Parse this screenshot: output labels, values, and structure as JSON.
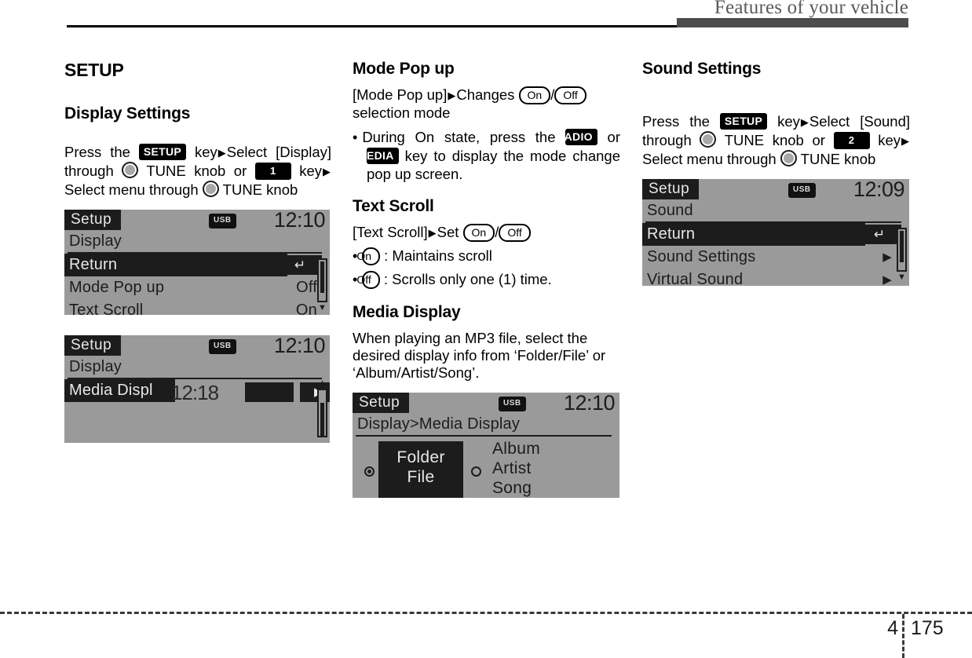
{
  "header": {
    "title": "Features of your vehicle"
  },
  "footer": {
    "chapter": "4",
    "page": "175"
  },
  "glyphs": {
    "setup_key": "SETUP",
    "radio_key": "RADIO",
    "media_key": "MEDIA",
    "key_1": "1",
    "key_2": "2",
    "on_pill": "On",
    "off_pill": "Off",
    "arrow": "▶",
    "usb_badge": "USB",
    "return_arrow": "↵",
    "submenu_arrow": "▶",
    "caret_down": "▼",
    "caret_up": "▲"
  },
  "column1": {
    "section_title": "SETUP",
    "display_settings": {
      "heading": "Display Settings",
      "instruction_parts": {
        "p1": "Press the",
        "p2": "key",
        "p3": "Select [Display]",
        "p4": "through",
        "p5": "TUNE knob or",
        "p6": "key",
        "p7": "Select menu through",
        "p8": "TUNE knob"
      }
    },
    "lcd_display_menu": {
      "title": "Setup",
      "usb": "USB",
      "clock": "12:10",
      "breadcrumb": "Display",
      "rows": [
        {
          "label": "Return",
          "value": "",
          "selected": true,
          "kind": "return"
        },
        {
          "label": "Mode Pop up",
          "value": "Off",
          "selected": false,
          "kind": "value"
        },
        {
          "label": "Text Scroll",
          "value": "On",
          "selected": false,
          "kind": "value"
        }
      ]
    },
    "lcd_media_menu": {
      "title": "Setup",
      "usb": "USB",
      "clock": "12:10",
      "breadcrumb": "Display",
      "rows": [
        {
          "label": "Media Displ",
          "value": "",
          "selected": true,
          "kind": "submenu"
        }
      ],
      "artifact_time": "12:18"
    }
  },
  "column2": {
    "mode_pop_up": {
      "heading": "Mode Pop up",
      "line1_a": "[Mode Pop up]",
      "line1_b": "Changes",
      "line1_on": "On",
      "line1_off": "Off",
      "line2": "selection mode",
      "bullet1_a": "During On state, press the",
      "bullet1_radio": "RADIO",
      "bullet1_b": "or",
      "bullet1_media": "MEDIA",
      "bullet1_c": "key to display the mode change pop up screen."
    },
    "text_scroll": {
      "heading": "Text Scroll",
      "line1_a": "[Text Scroll]",
      "line1_b": "Set",
      "line1_on": "On",
      "line1_off": "Off",
      "bullet1_pill": "On",
      "bullet1_text": ": Maintains scroll",
      "bullet2_pill": "Off",
      "bullet2_text": ": Scrolls only one (1) time."
    },
    "media_display": {
      "heading": "Media Display",
      "body": "When playing an MP3 file, select the desired display info from ‘Folder/File’ or ‘Album/Artist/Song’."
    },
    "lcd_media_display": {
      "title": "Setup",
      "usb": "USB",
      "clock": "12:10",
      "breadcrumb": "Display>Media Display",
      "option_selected": {
        "line1": "Folder",
        "line2": "File"
      },
      "option_other": {
        "line1": "Album",
        "line2": "Artist",
        "line3": "Song"
      }
    }
  },
  "column3": {
    "sound_settings": {
      "heading": "Sound Settings",
      "instruction_parts": {
        "p1": "Press the",
        "p2": "key",
        "p3": "Select [Sound]",
        "p4": "through",
        "p5": "TUNE knob or",
        "p6": "key",
        "p7": "Select menu through",
        "p8": "TUNE knob"
      }
    },
    "lcd_sound_menu": {
      "title": "Setup",
      "usb": "USB",
      "clock": "12:09",
      "breadcrumb": "Sound",
      "rows": [
        {
          "label": "Return",
          "value": "",
          "selected": true,
          "kind": "return"
        },
        {
          "label": "Sound Settings",
          "value": "",
          "selected": false,
          "kind": "submenu"
        },
        {
          "label": "Virtual Sound",
          "value": "",
          "selected": false,
          "kind": "submenu"
        }
      ]
    }
  }
}
